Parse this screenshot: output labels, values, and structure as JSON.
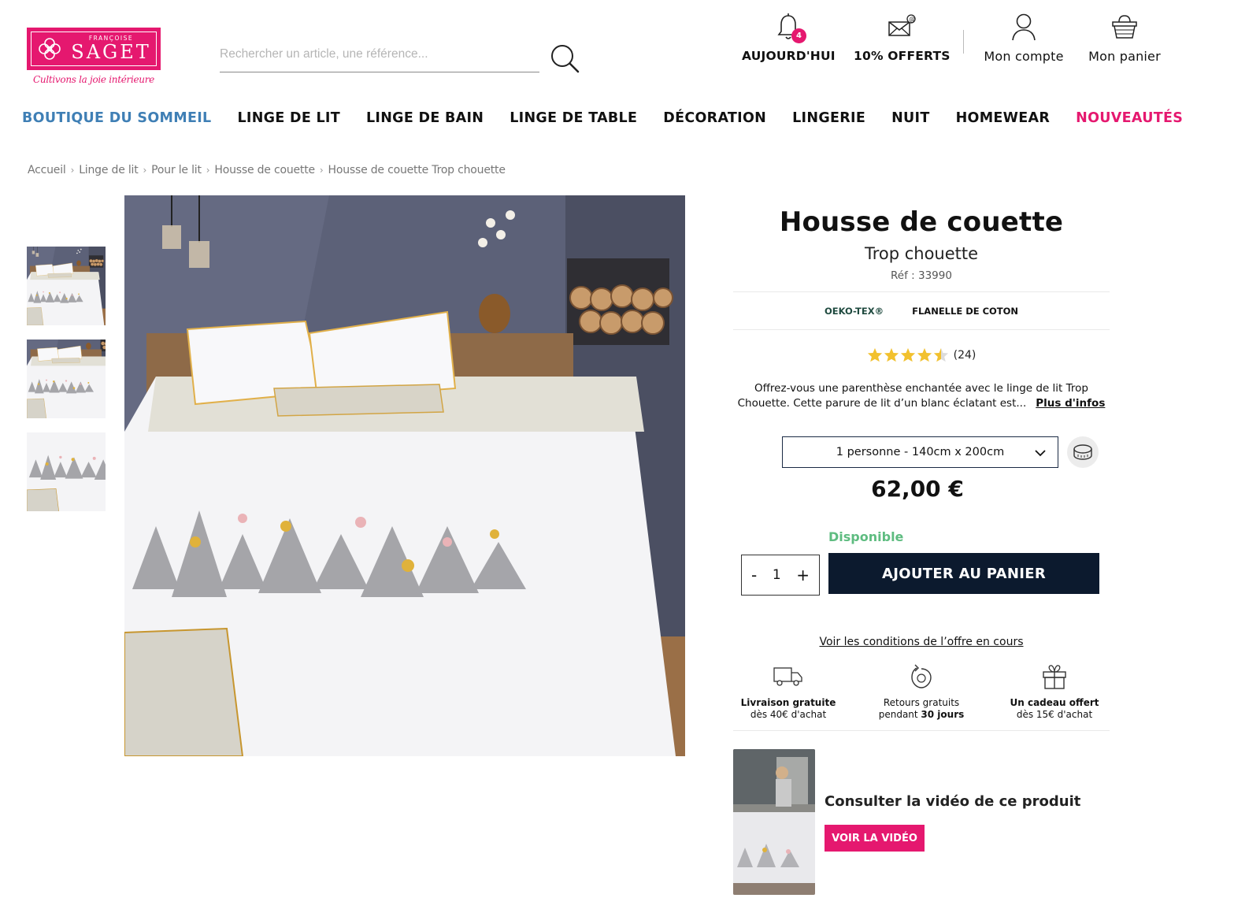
{
  "brand": {
    "name": "SAGET",
    "prefix": "FRANÇOISE",
    "tagline": "Cultivons la joie intérieure",
    "color": "#e5186f"
  },
  "search": {
    "placeholder": "Rechercher un article, une référence...",
    "value": ""
  },
  "header": {
    "notifications": {
      "label": "AUJOURD'HUI",
      "badge": "4",
      "icon": "bell-icon"
    },
    "offer": {
      "label": "10% OFFERTS",
      "icon": "mail-icon"
    },
    "account": {
      "label": "Mon compte",
      "icon": "user-icon"
    },
    "cart": {
      "label": "Mon panier",
      "icon": "basket-icon"
    }
  },
  "nav": [
    {
      "label": "BOUTIQUE DU SOMMEIL",
      "color": "#3f7fb5"
    },
    {
      "label": "LINGE DE LIT",
      "color": "#111111"
    },
    {
      "label": "LINGE DE BAIN",
      "color": "#111111"
    },
    {
      "label": "LINGE DE TABLE",
      "color": "#111111"
    },
    {
      "label": "DÉCORATION",
      "color": "#111111"
    },
    {
      "label": "LINGERIE",
      "color": "#111111"
    },
    {
      "label": "NUIT",
      "color": "#111111"
    },
    {
      "label": "HOMEWEAR",
      "color": "#111111"
    },
    {
      "label": "NOUVEAUTÉS",
      "color": "#e5186f"
    }
  ],
  "breadcrumb": [
    "Accueil",
    "Linge de lit",
    "Pour le lit",
    "Housse de couette",
    "Housse de couette Trop chouette"
  ],
  "product": {
    "title": "Housse de couette",
    "subtitle": "Trop chouette",
    "ref": "Réf : 33990",
    "tags": [
      "OEKO-TEX®",
      "FLANELLE DE COTON"
    ],
    "rating": 4.5,
    "rating_count": "(24)",
    "description": "Offrez-vous une parenthèse enchantée avec le linge de lit Trop Chouette. Cette parure de lit d’un blanc éclatant est...",
    "more_label": "Plus d'infos",
    "size_selected": "1 personne - 140cm x 200cm",
    "price": "62,00 €",
    "availability": "Disponible",
    "quantity": "1",
    "qty_minus": "-",
    "qty_plus": "+",
    "add_to_cart": "AJOUTER AU PANIER",
    "offer_conditions": "Voir les conditions de l’offre en cours"
  },
  "perks": [
    {
      "icon": "truck-icon",
      "line1": "Livraison gratuite",
      "line2": "dès 40€ d'achat"
    },
    {
      "icon": "return-icon",
      "line1": "Retours gratuits",
      "line2_prefix": "pendant ",
      "line2_bold": "30 jours"
    },
    {
      "icon": "gift-icon",
      "line1": "Un cadeau offert",
      "line2": "dès 15€ d'achat"
    }
  ],
  "video": {
    "title": "Consulter la vidéo de ce produit",
    "button": "VOIR LA VIDÉO"
  }
}
